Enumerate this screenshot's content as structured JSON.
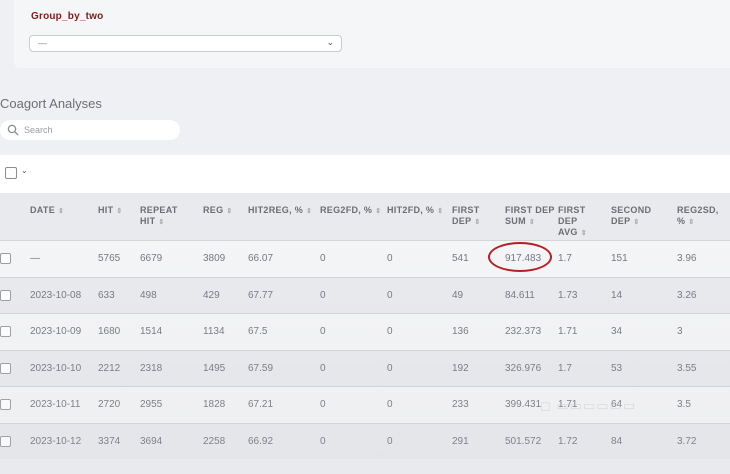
{
  "filter": {
    "label": "Group_by_two",
    "select_value": "—"
  },
  "section": {
    "title": "Coagort Analyses"
  },
  "search": {
    "placeholder": "Search"
  },
  "table": {
    "columns": [
      "DATE",
      "HIT",
      "REPEAT HIT",
      "REG",
      "HIT2REG, %",
      "REG2FD, %",
      "HIT2FD, %",
      "FIRST DEP",
      "FIRST DEP SUM",
      "FIRST DEP AVG",
      "SECOND DEP",
      "REG2SD, %"
    ],
    "rows": [
      [
        "—",
        "5765",
        "6679",
        "3809",
        "66.07",
        "0",
        "0",
        "541",
        "917.483",
        "1.7",
        "151",
        "3.96"
      ],
      [
        "2023-10-08",
        "633",
        "498",
        "429",
        "67.77",
        "0",
        "0",
        "49",
        "84.611",
        "1.73",
        "14",
        "3.26"
      ],
      [
        "2023-10-09",
        "1680",
        "1514",
        "1134",
        "67.5",
        "0",
        "0",
        "136",
        "232.373",
        "1.71",
        "34",
        "3"
      ],
      [
        "2023-10-10",
        "2212",
        "2318",
        "1495",
        "67.59",
        "0",
        "0",
        "192",
        "326.976",
        "1.7",
        "53",
        "3.55"
      ],
      [
        "2023-10-11",
        "2720",
        "2955",
        "1828",
        "67.21",
        "0",
        "0",
        "233",
        "399.431",
        "1.71",
        "64",
        "3.5"
      ],
      [
        "2023-10-12",
        "3374",
        "3694",
        "2258",
        "66.92",
        "0",
        "0",
        "291",
        "501.572",
        "1.72",
        "84",
        "3.72"
      ]
    ]
  },
  "colors": {
    "accent": "#7a1e1e",
    "highlight": "#b31e24"
  }
}
